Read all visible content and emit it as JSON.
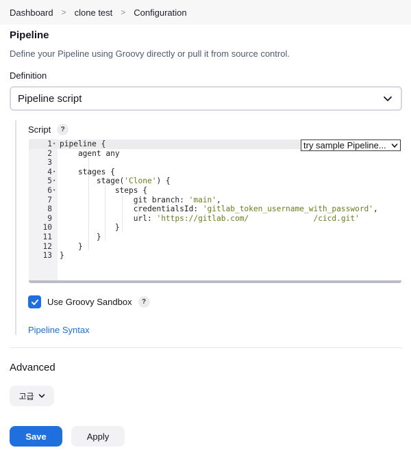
{
  "breadcrumb": {
    "items": [
      "Dashboard",
      "clone test",
      "Configuration"
    ]
  },
  "pipeline": {
    "title": "Pipeline",
    "description": "Define your Pipeline using Groovy directly or pull it from source control.",
    "definition_label": "Definition",
    "definition_value": "Pipeline script"
  },
  "script": {
    "label": "Script",
    "help": "?",
    "sample_select": "try sample Pipeline...",
    "lines": [
      {
        "n": "1",
        "code": "pipeline {"
      },
      {
        "n": "2",
        "code": "    agent any"
      },
      {
        "n": "3",
        "code": ""
      },
      {
        "n": "4",
        "code": "    stages {"
      },
      {
        "n": "5",
        "code": "        stage('Clone') {"
      },
      {
        "n": "6",
        "code": "            steps {"
      },
      {
        "n": "7",
        "code": "                git branch: 'main',"
      },
      {
        "n": "8",
        "code": "                credentialsId: 'gitlab_token_username_with_password',"
      },
      {
        "n": "9",
        "code": "                url: 'https://gitlab.com/              /cicd.git'"
      },
      {
        "n": "10",
        "code": "            }"
      },
      {
        "n": "11",
        "code": "        }"
      },
      {
        "n": "12",
        "code": "    }"
      },
      {
        "n": "13",
        "code": "}"
      }
    ],
    "folds": [
      "1",
      "4",
      "5",
      "6"
    ]
  },
  "sandbox": {
    "label": "Use Groovy Sandbox",
    "checked": true,
    "help": "?"
  },
  "syntax_link": "Pipeline Syntax",
  "advanced": {
    "title": "Advanced",
    "button_label": "고급"
  },
  "actions": {
    "save_label": "Save",
    "apply_label": "Apply"
  },
  "colors": {
    "accent": "#1f6fde",
    "link": "#1f6fd6",
    "string": "#6e7b1c"
  }
}
